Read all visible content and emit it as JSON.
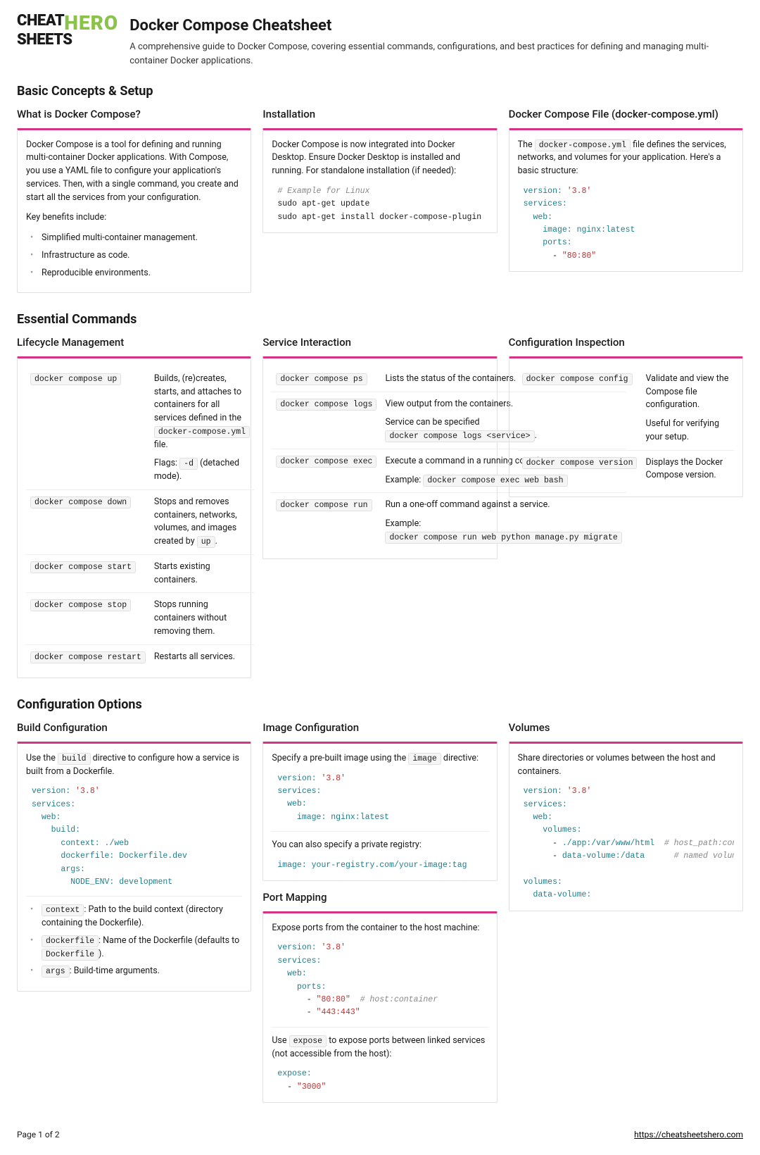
{
  "logo": {
    "line1a": "CHEAT",
    "line1b": "HERO",
    "line2": "SHEETS"
  },
  "title": "Docker Compose Cheatsheet",
  "subtitle": "A comprehensive guide to Docker Compose, covering essential commands, configurations, and best practices for defining and managing multi-container Docker applications.",
  "sections": {
    "basic": {
      "heading": "Basic Concepts & Setup",
      "what": {
        "title": "What is Docker Compose?",
        "p1": "Docker Compose is a tool for defining and running multi-container Docker applications. With Compose, you use a YAML file to configure your application's services. Then, with a single command, you create and start all the services from your configuration.",
        "p2": "Key benefits include:",
        "bullets": [
          "Simplified multi-container management.",
          "Infrastructure as code.",
          "Reproducible environments."
        ]
      },
      "install": {
        "title": "Installation",
        "p1": "Docker Compose is now integrated into Docker Desktop. Ensure Docker Desktop is installed and running. For standalone installation (if needed):",
        "code": {
          "c1": "# Example for Linux",
          "c2": "sudo apt-get update",
          "c3": "sudo apt-get install docker-compose-plugin"
        }
      },
      "file": {
        "title": "Docker Compose File (docker-compose.yml)",
        "p1a": "The ",
        "p1code": "docker-compose.yml",
        "p1b": " file defines the services, networks, and volumes for your application. Here's a basic structure:",
        "code": {
          "version_k": "version:",
          "version_v": "'3.8'",
          "services_k": "services:",
          "web_k": "web:",
          "image_k": "image:",
          "image_v": "nginx:latest",
          "ports_k": "ports:",
          "ports_v": "\"80:80\""
        }
      }
    },
    "essential": {
      "heading": "Essential Commands",
      "lifecycle": {
        "title": "Lifecycle Management",
        "rows": [
          {
            "cmd": "docker compose up",
            "d1a": "Builds, (re)creates, starts, and attaches to containers for all services defined in the ",
            "d1code": "docker-compose.yml",
            "d1b": " file.",
            "d2a": "Flags: ",
            "d2code": "-d",
            "d2b": " (detached mode)."
          },
          {
            "cmd": "docker compose down",
            "d1a": "Stops and removes containers, networks, volumes, and images created by ",
            "d1code": "up",
            "d1b": "."
          },
          {
            "cmd": "docker compose start",
            "d1a": "Starts existing containers."
          },
          {
            "cmd": "docker compose stop",
            "d1a": "Stops running containers without removing them."
          },
          {
            "cmd": "docker compose restart",
            "d1a": "Restarts all services."
          }
        ]
      },
      "service": {
        "title": "Service Interaction",
        "rows": [
          {
            "cmd": "docker compose ps",
            "d1a": "Lists the status of the containers."
          },
          {
            "cmd": "docker compose logs",
            "d1a": "View output from the containers.",
            "d2a": "Service can be specified ",
            "d2code": "docker compose logs <service>",
            "d2b": "."
          },
          {
            "cmd": "docker compose exec",
            "d1a": "Execute a command in a running container.",
            "d2a": "Example: ",
            "d2code": "docker compose exec web bash"
          },
          {
            "cmd": "docker compose run",
            "d1a": "Run a one-off command against a service.",
            "d2a": "Example: ",
            "d2code": "docker compose run web python manage.py migrate"
          }
        ]
      },
      "config": {
        "title": "Configuration Inspection",
        "rows": [
          {
            "cmd": "docker compose config",
            "d1a": "Validate and view the Compose file configuration.",
            "d2a": "Useful for verifying your setup."
          },
          {
            "cmd": "docker compose version",
            "d1a": "Displays the Docker Compose version."
          }
        ]
      }
    },
    "options": {
      "heading": "Configuration Options",
      "build": {
        "title": "Build Configuration",
        "p1a": "Use the ",
        "p1code": "build",
        "p1b": " directive to configure how a service is built from a Dockerfile.",
        "code": {
          "version_k": "version:",
          "version_v": "'3.8'",
          "services_k": "services:",
          "web_k": "web:",
          "build_k": "build:",
          "context_k": "context:",
          "context_v": "./web",
          "dockerfile_k": "dockerfile:",
          "dockerfile_v": "Dockerfile.dev",
          "args_k": "args:",
          "nodeenv_k": "NODE_ENV:",
          "nodeenv_v": "development"
        },
        "bullets": [
          {
            "code": "context",
            "text": ": Path to the build context (directory containing the Dockerfile)."
          },
          {
            "code": "dockerfile",
            "text_a": ": Name of the Dockerfile (defaults to ",
            "text_code": "Dockerfile",
            "text_b": ")."
          },
          {
            "code": "args",
            "text": ": Build-time arguments."
          }
        ]
      },
      "image": {
        "title": "Image Configuration",
        "p1a": "Specify a pre-built image using the ",
        "p1code": "image",
        "p1b": " directive:",
        "code1": {
          "version_k": "version:",
          "version_v": "'3.8'",
          "services_k": "services:",
          "web_k": "web:",
          "image_k": "image:",
          "image_v": "nginx:latest"
        },
        "p2": "You can also specify a private registry:",
        "code2_k": "image:",
        "code2_v": "your-registry.com/your-image:tag"
      },
      "port": {
        "title": "Port Mapping",
        "p1": "Expose ports from the container to the host machine:",
        "code1": {
          "version_k": "version:",
          "version_v": "'3.8'",
          "services_k": "services:",
          "web_k": "web:",
          "ports_k": "ports:",
          "p1": "\"80:80\"",
          "p1c": "# host:container",
          "p2": "\"443:443\""
        },
        "p2a": "Use ",
        "p2code": "expose",
        "p2b": " to expose ports between linked services (not accessible from the host):",
        "code2_k": "expose:",
        "code2_v": "\"3000\""
      },
      "volumes": {
        "title": "Volumes",
        "p1": "Share directories or volumes between the host and containers.",
        "code": {
          "version_k": "version:",
          "version_v": "'3.8'",
          "services_k": "services:",
          "web_k": "web:",
          "volumes_k": "volumes:",
          "v1": "./app:/var/www/html",
          "v1c": "# host_path:container_path",
          "v2": "data-volume:/data",
          "v2c": "# named volume",
          "volumes2_k": "volumes:",
          "dv_k": "data-volume:"
        }
      }
    }
  },
  "footer": {
    "page": "Page 1 of 2",
    "url": "https://cheatsheetshero.com"
  }
}
